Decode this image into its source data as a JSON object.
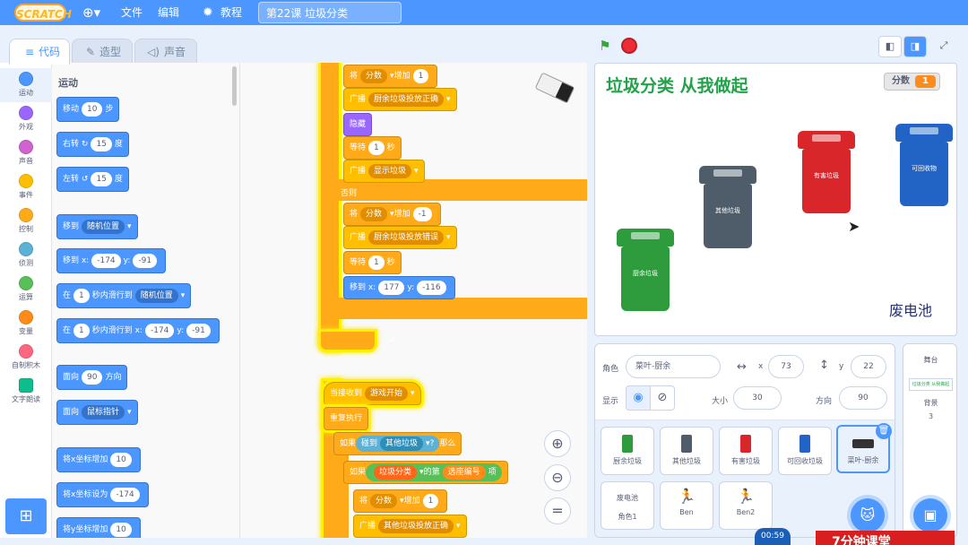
{
  "menubar": {
    "logo": "SCRATCH",
    "file": "文件",
    "edit": "编辑",
    "tutorials": "教程",
    "project_title": "第22课 垃圾分类"
  },
  "tabs": {
    "code": "代码",
    "costumes": "造型",
    "sounds": "声音"
  },
  "categories": [
    {
      "label": "运动",
      "color": "#4c97ff"
    },
    {
      "label": "外观",
      "color": "#9966ff"
    },
    {
      "label": "声音",
      "color": "#cf63cf"
    },
    {
      "label": "事件",
      "color": "#ffbf00"
    },
    {
      "label": "控制",
      "color": "#ffab19"
    },
    {
      "label": "侦测",
      "color": "#5cb1d6"
    },
    {
      "label": "运算",
      "color": "#59c059"
    },
    {
      "label": "变量",
      "color": "#ff8c1a"
    },
    {
      "label": "自制积木",
      "color": "#ff6680"
    },
    {
      "label": "文字朗读",
      "color": "#0fbd8c"
    }
  ],
  "palette": {
    "title": "运动",
    "move": {
      "a": "移动",
      "v": "10",
      "b": "步"
    },
    "turn_right": {
      "a": "右转",
      "v": "15",
      "b": "度"
    },
    "turn_left": {
      "a": "左转",
      "v": "15",
      "b": "度"
    },
    "goto": {
      "a": "移到",
      "v": "随机位置"
    },
    "goto_xy": {
      "a": "移到 x:",
      "x": "-174",
      "b": "y:",
      "y": "-91"
    },
    "glide": {
      "a": "在",
      "v": "1",
      "b": "秒内滑行到",
      "t": "随机位置"
    },
    "glide_xy": {
      "a": "在",
      "v": "1",
      "b": "秒内滑行到 x:",
      "x": "-174",
      "c": "y:",
      "y": "-91"
    },
    "point": {
      "a": "面向",
      "v": "90",
      "b": "方向"
    },
    "point_towards": {
      "a": "面向",
      "v": "鼠标指针"
    },
    "change_x": {
      "a": "将x坐标增加",
      "v": "10"
    },
    "set_x": {
      "a": "将x坐标设为",
      "v": "-174"
    },
    "change_y": {
      "a": "将y坐标增加",
      "v": "10"
    }
  },
  "script": {
    "change_score1": {
      "a": "将",
      "var": "分数",
      "b": "增加",
      "v": "1"
    },
    "broadcast1": {
      "a": "广播",
      "msg": "厨余垃圾投放正确"
    },
    "hide": "隐藏",
    "wait1": {
      "a": "等待",
      "v": "1",
      "b": "秒"
    },
    "broadcast2": {
      "a": "广播",
      "msg": "显示垃圾"
    },
    "else": "否则",
    "change_score2": {
      "a": "将",
      "var": "分数",
      "b": "增加",
      "v": "-1"
    },
    "broadcast3": {
      "a": "广播",
      "msg": "厨余垃圾投放错误"
    },
    "wait2": {
      "a": "等待",
      "v": "1",
      "b": "秒"
    },
    "goto_xy": {
      "a": "移到 x:",
      "x": "177",
      "b": "y:",
      "y": "-116"
    },
    "when_receive": {
      "a": "当接收到",
      "msg": "游戏开始"
    },
    "forever": "重复执行",
    "if_touch": {
      "a": "如果",
      "s": "碰到",
      "t": "其他垃圾",
      "q": "?",
      "b": "那么"
    },
    "if_eq": {
      "a": "如果",
      "list": "垃圾分类",
      "of": "的第",
      "idx": "选座编号",
      "item": "项"
    },
    "change_score3": {
      "a": "将",
      "var": "分数",
      "b": "增加",
      "v": "1"
    },
    "broadcast4": {
      "a": "广播",
      "msg": "其他垃圾投放正确"
    }
  },
  "stage": {
    "title": "垃圾分类  从我做起",
    "score_label": "分数",
    "score_value": "1",
    "battery": "废电池",
    "bins": [
      {
        "color": "#2e9b3c",
        "label": "厨余垃圾"
      },
      {
        "color": "#4f5d6b",
        "label": "其他垃圾"
      },
      {
        "color": "#d9262b",
        "label": "有害垃圾"
      },
      {
        "color": "#2264c6",
        "label": "可回收物"
      }
    ]
  },
  "sprite_info": {
    "sprite_label": "角色",
    "sprite_name": "菜叶-厨余",
    "x_label": "x",
    "x": "73",
    "y_label": "y",
    "y": "22",
    "show_label": "显示",
    "size_label": "大小",
    "size": "30",
    "direction_label": "方向",
    "direction": "90"
  },
  "sprites": [
    {
      "name": "厨余垃圾",
      "color": "#2e9b3c"
    },
    {
      "name": "其他垃圾",
      "color": "#4f5d6b"
    },
    {
      "name": "有害垃圾",
      "color": "#d9262b"
    },
    {
      "name": "可回收垃圾",
      "color": "#2264c6"
    },
    {
      "name": "菜叶-厨余",
      "color": "#333333"
    },
    {
      "name": "角色1",
      "thumb_text": "废电池"
    },
    {
      "name": "Ben",
      "color": "#d9262b"
    },
    {
      "name": "Ben2",
      "color": "#d9262b"
    }
  ],
  "stage_panel": {
    "title": "舞台",
    "thumb": "垃圾分类 从我做起",
    "backdrop_label": "背景",
    "backdrop_count": "3"
  },
  "timer": "00:59",
  "watermark": "7分钟课堂"
}
